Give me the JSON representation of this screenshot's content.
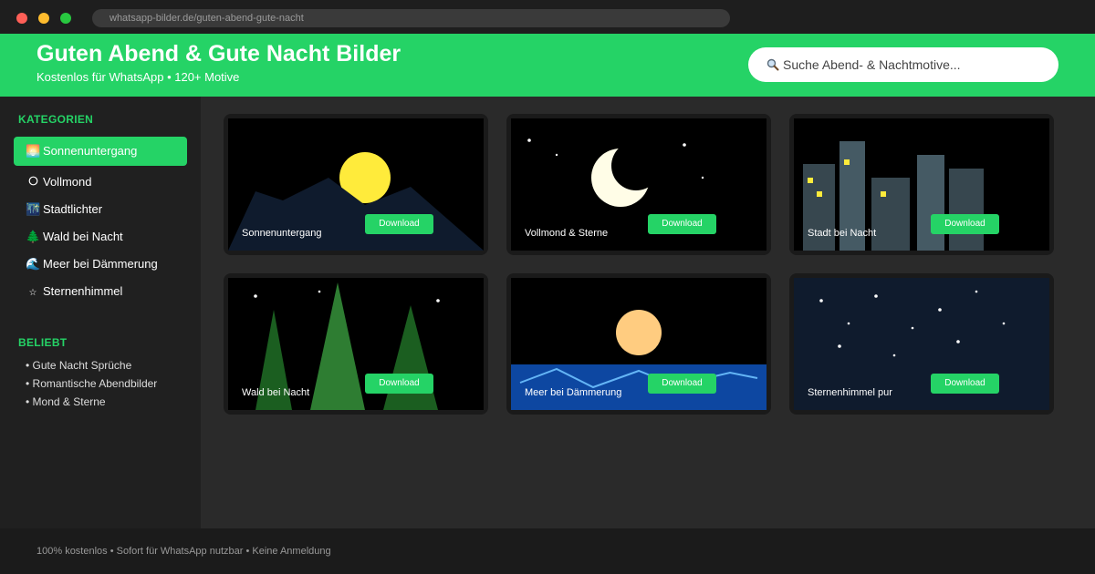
{
  "browser": {
    "url": "whatsapp-bilder.de/guten-abend-gute-nacht"
  },
  "header": {
    "title": "Guten Abend & Gute Nacht Bilder",
    "subtitle": "Kostenlos für WhatsApp • 120+ Motive",
    "search_placeholder": "Suche Abend- & Nachtmotive..."
  },
  "sidebar": {
    "categories_heading": "KATEGORIEN",
    "categories": [
      {
        "icon": "🌅",
        "icon_name": "sunset-icon",
        "label": "Sonnenuntergang",
        "active": true
      },
      {
        "icon": "🌕",
        "icon_name": "full-moon-icon",
        "label": "Vollmond",
        "active": false
      },
      {
        "icon": "🌃",
        "icon_name": "city-lights-icon",
        "label": "Stadtlichter",
        "active": false
      },
      {
        "icon": "🌲",
        "icon_name": "tree-icon",
        "label": "Wald bei Nacht",
        "active": false
      },
      {
        "icon": "🌊",
        "icon_name": "wave-icon",
        "label": "Meer bei Dämmerung",
        "active": false
      },
      {
        "icon": "⭐",
        "icon_name": "star-icon",
        "label": "Sternenhimmel",
        "active": false
      }
    ],
    "popular_heading": "BELIEBT",
    "popular": [
      "• Gute Nacht Sprüche",
      "• Romantische Abendbilder",
      "• Mond & Sterne"
    ]
  },
  "cards": [
    {
      "label": "Sonnenuntergang",
      "button": "Download"
    },
    {
      "label": "Vollmond & Sterne",
      "button": "Download"
    },
    {
      "label": "Stadt bei Nacht",
      "button": "Download"
    },
    {
      "label": "Wald bei Nacht",
      "button": "Download"
    },
    {
      "label": "Meer bei Dämmerung",
      "button": "Download"
    },
    {
      "label": "Sternenhimmel pur",
      "button": "Download"
    }
  ],
  "footer": {
    "text": "100% kostenlos • Sofort für WhatsApp nutzbar • Keine Anmeldung"
  },
  "colors": {
    "accent": "#25d366",
    "sidebar_bg": "#202020",
    "main_bg": "#2a2a2a"
  }
}
